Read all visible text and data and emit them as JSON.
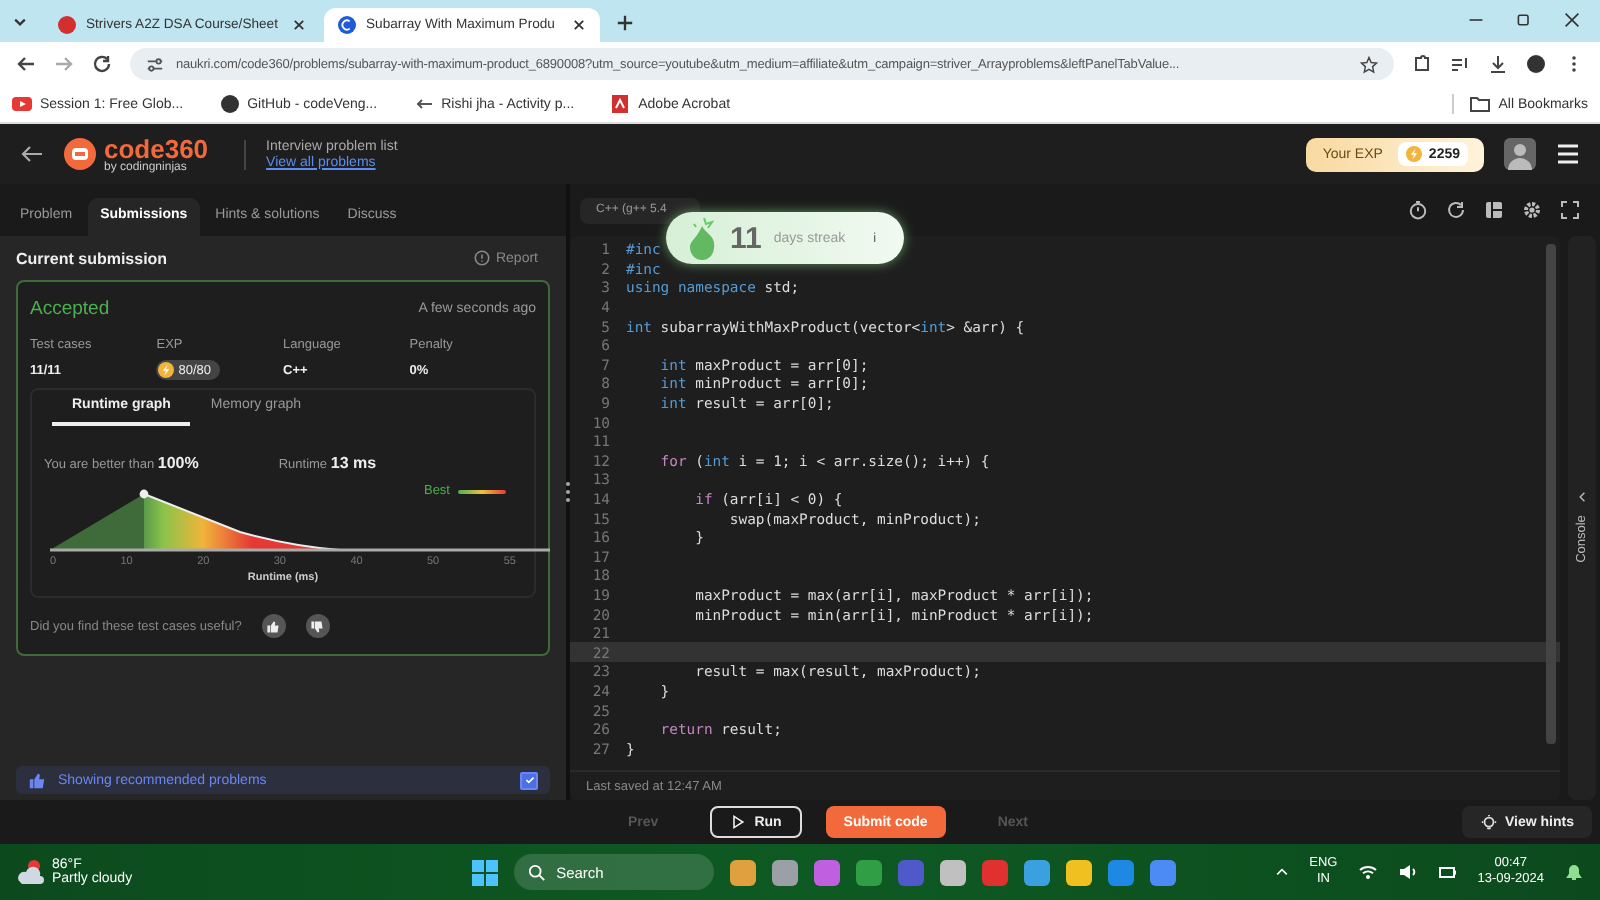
{
  "browser": {
    "tabs": [
      {
        "title": "Strivers A2Z DSA Course/Sheet",
        "selected": false
      },
      {
        "title": "Subarray With Maximum Produ",
        "selected": true
      }
    ],
    "url": "naukri.com/code360/problems/subarray-with-maximum-product_6890008?utm_source=youtube&utm_medium=affiliate&utm_campaign=striver_Arrayproblems&leftPanelTabValue...",
    "bookmarks": [
      "Session 1: Free Glob...",
      "GitHub - codeVeng...",
      "Rishi jha - Activity p...",
      "Adobe Acrobat"
    ],
    "all_bookmarks": "All Bookmarks"
  },
  "header": {
    "logo": "code360",
    "logo_sub": "by codingninjas",
    "list_caption": "Interview problem list",
    "list_link": "View all problems",
    "exp_label": "Your EXP",
    "exp_value": "2259"
  },
  "left_tabs": [
    {
      "label": "Problem",
      "selected": false
    },
    {
      "label": "Submissions",
      "selected": true
    },
    {
      "label": "Hints & solutions",
      "selected": false
    },
    {
      "label": "Discuss",
      "selected": false
    }
  ],
  "submission": {
    "heading": "Current submission",
    "report": "Report",
    "status": "Accepted",
    "time": "A few seconds ago",
    "stats": [
      {
        "label": "Test cases",
        "value": "11/11",
        "kind": "text"
      },
      {
        "label": "EXP",
        "value": "80/80",
        "kind": "coin"
      },
      {
        "label": "Language",
        "value": "C++",
        "kind": "text"
      },
      {
        "label": "Penalty",
        "value": "0%",
        "kind": "text"
      }
    ],
    "graph_tabs": [
      {
        "label": "Runtime graph",
        "selected": true
      },
      {
        "label": "Memory graph",
        "selected": false
      }
    ],
    "better_label": "You are better than",
    "better_value": "100%",
    "runtime_label": "Runtime",
    "runtime_value": "13 ms",
    "legend": "Best",
    "x_ticks": [
      "0",
      "10",
      "20",
      "30",
      "40",
      "50",
      "55"
    ],
    "xlabel": "Runtime (ms)",
    "feedback": "Did you find these test cases useful?"
  },
  "banner": {
    "text": "Showing recommended problems",
    "checked": true
  },
  "editor": {
    "language": "C++ (g++ 5.4",
    "console": "Console",
    "last_saved": "Last saved at 12:47 AM",
    "lines": [
      {
        "num": "1",
        "current": false,
        "tokens": [
          {
            "kind": "kw",
            "text": "#inc"
          }
        ]
      },
      {
        "num": "2",
        "current": false,
        "tokens": [
          {
            "kind": "kw",
            "text": "#inc"
          }
        ]
      },
      {
        "num": "3",
        "current": false,
        "tokens": [
          {
            "kind": "kw",
            "text": "using namespace"
          },
          {
            "kind": "plain",
            "text": " std;"
          }
        ]
      },
      {
        "num": "4",
        "current": false
      },
      {
        "num": "5",
        "current": false,
        "tokens": [
          {
            "kind": "kw",
            "text": "int"
          },
          {
            "kind": "plain",
            "text": " subarrayWithMaxProduct(vector<"
          },
          {
            "kind": "kw",
            "text": "int"
          },
          {
            "kind": "plain",
            "text": "> &arr) {"
          }
        ]
      },
      {
        "num": "6",
        "current": false
      },
      {
        "num": "7",
        "current": false,
        "tokens": [
          {
            "kind": "kw",
            "text": "    int"
          },
          {
            "kind": "plain",
            "text": " maxProduct = arr[0];"
          }
        ]
      },
      {
        "num": "8",
        "current": false,
        "tokens": [
          {
            "kind": "kw",
            "text": "    int"
          },
          {
            "kind": "plain",
            "text": " minProduct = arr[0];"
          }
        ]
      },
      {
        "num": "9",
        "current": false,
        "tokens": [
          {
            "kind": "kw",
            "text": "    int"
          },
          {
            "kind": "plain",
            "text": " result = arr[0];"
          }
        ]
      },
      {
        "num": "10",
        "current": false
      },
      {
        "num": "11",
        "current": false
      },
      {
        "num": "12",
        "current": false,
        "tokens": [
          {
            "kind": "ctl",
            "text": "    for"
          },
          {
            "kind": "plain",
            "text": " ("
          },
          {
            "kind": "kw",
            "text": "int"
          },
          {
            "kind": "plain",
            "text": " i = 1; i < arr.size(); i++) {"
          }
        ]
      },
      {
        "num": "13",
        "current": false
      },
      {
        "num": "14",
        "current": false,
        "tokens": [
          {
            "kind": "ctl",
            "text": "        if"
          },
          {
            "kind": "plain",
            "text": " (arr[i] < 0) {"
          }
        ]
      },
      {
        "num": "15",
        "current": false,
        "tokens": [
          {
            "kind": "plain",
            "text": "            swap(maxProduct, minProduct);"
          }
        ]
      },
      {
        "num": "16",
        "current": false,
        "tokens": [
          {
            "kind": "plain",
            "text": "        }"
          }
        ]
      },
      {
        "num": "17",
        "current": false
      },
      {
        "num": "18",
        "current": false
      },
      {
        "num": "19",
        "current": false,
        "tokens": [
          {
            "kind": "plain",
            "text": "        maxProduct = max(arr[i], maxProduct * arr[i]);"
          }
        ]
      },
      {
        "num": "20",
        "current": false,
        "tokens": [
          {
            "kind": "plain",
            "text": "        minProduct = min(arr[i], minProduct * arr[i]);"
          }
        ]
      },
      {
        "num": "21",
        "current": false
      },
      {
        "num": "22",
        "current": true
      },
      {
        "num": "23",
        "current": false,
        "tokens": [
          {
            "kind": "plain",
            "text": "        result = max(result, maxProduct);"
          }
        ]
      },
      {
        "num": "24",
        "current": false,
        "tokens": [
          {
            "kind": "plain",
            "text": "    }"
          }
        ]
      },
      {
        "num": "25",
        "current": false
      },
      {
        "num": "26",
        "current": false,
        "tokens": [
          {
            "kind": "ctl",
            "text": "    return"
          },
          {
            "kind": "plain",
            "text": " result;"
          }
        ]
      },
      {
        "num": "27",
        "current": false,
        "tokens": [
          {
            "kind": "plain",
            "text": "}"
          }
        ]
      }
    ]
  },
  "streak": {
    "count": "11",
    "label": "days streak",
    "info": "i"
  },
  "footer": {
    "buttons": [
      {
        "label": "Prev",
        "kind": "ghost",
        "disabled": true
      },
      {
        "label": "Run",
        "kind": "run",
        "disabled": false
      },
      {
        "label": "Submit code",
        "kind": "submit",
        "disabled": false
      },
      {
        "label": "Next",
        "kind": "ghost",
        "disabled": true
      }
    ],
    "hints": "View hints"
  },
  "taskbar": {
    "temp": "86°F",
    "weather": "Partly cloudy",
    "search": "Search",
    "lang": "ENG",
    "region": "IN",
    "time": "00:47",
    "date": "13-09-2024"
  }
}
